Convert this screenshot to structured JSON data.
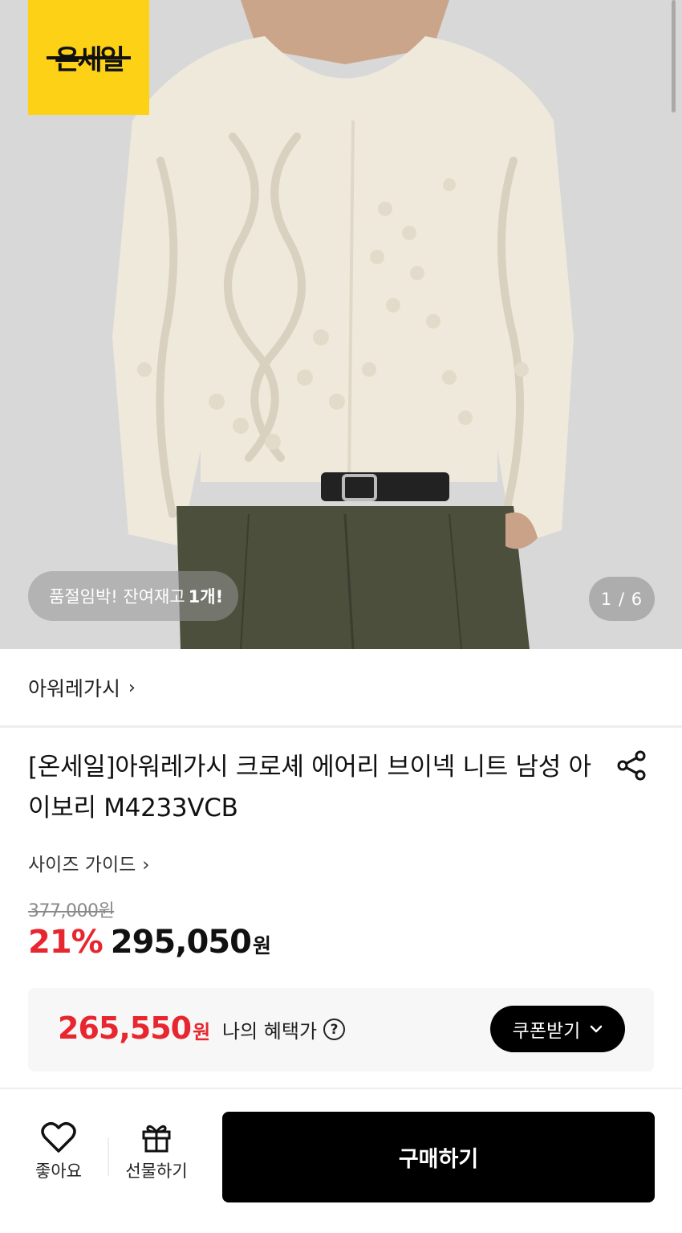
{
  "hero": {
    "badge_text": "온세일",
    "stock_text": "품절임박! 잔여재고",
    "stock_count": "1개!",
    "image_counter": "1 / 6"
  },
  "brand": {
    "name": "아워레가시",
    "chevron": "›"
  },
  "product": {
    "title": "[온세일]아워레가시 크로셰 에어리 브이넥 니트 남성 아이보리 M4233VCB",
    "size_guide": "사이즈 가이드",
    "size_guide_chevron": "›",
    "original_price": "377,000원",
    "discount": "21%",
    "price": "295,050",
    "price_unit": "원"
  },
  "benefit": {
    "price": "265,550",
    "price_unit": "원",
    "label": "나의 혜택가",
    "help": "?",
    "coupon_button": "쿠폰받기",
    "coupon_chevron": "⌄"
  },
  "bottom_bar": {
    "like_label": "좋아요",
    "gift_label": "선물하기",
    "buy_label": "구매하기"
  },
  "colors": {
    "badge_yellow": "#fcd116",
    "accent_red": "#e8262f",
    "primary_black": "#000000"
  },
  "icons": [
    "heart-icon",
    "gift-icon",
    "share-icon",
    "help-icon",
    "chevron-right-icon",
    "chevron-down-icon"
  ]
}
